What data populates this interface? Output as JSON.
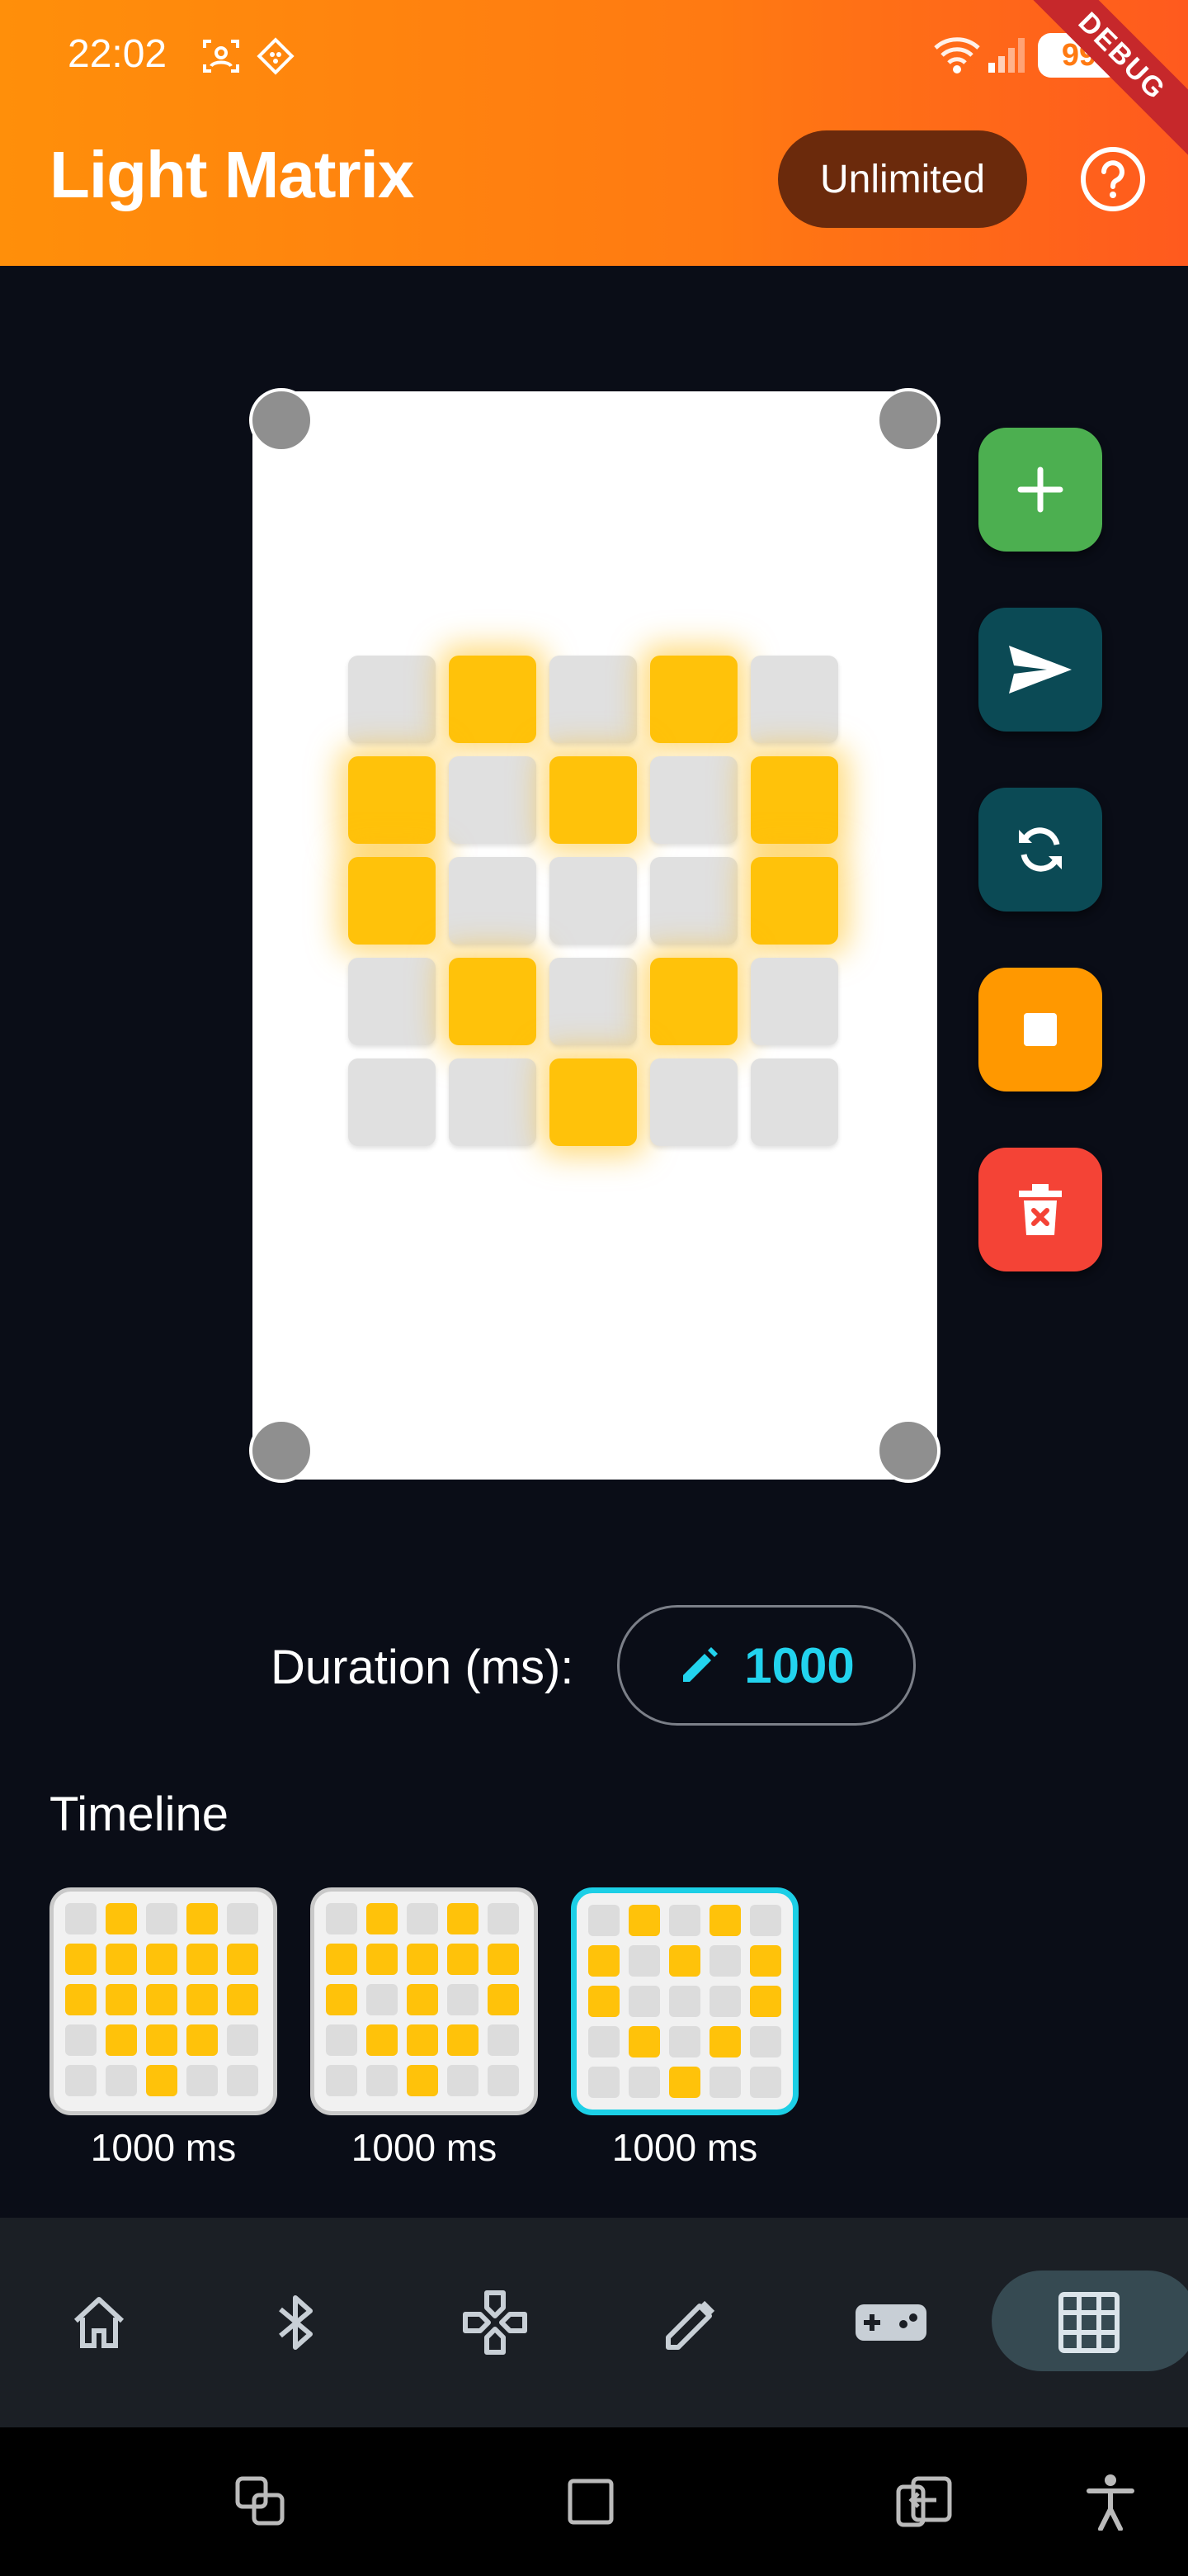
{
  "status_bar": {
    "time": "22:02",
    "battery": "99"
  },
  "debug_banner": "DEBUG",
  "app_bar": {
    "title": "Light Matrix",
    "plan_badge": "Unlimited",
    "help_icon": "help-circle-icon"
  },
  "matrix": {
    "rows": 5,
    "cols": 5,
    "on_color": "#ffc20a",
    "off_color": "#e0e0e0",
    "cells": [
      [
        0,
        1,
        0,
        1,
        0
      ],
      [
        1,
        0,
        1,
        0,
        1
      ],
      [
        1,
        0,
        0,
        0,
        1
      ],
      [
        0,
        1,
        0,
        1,
        0
      ],
      [
        0,
        0,
        1,
        0,
        0
      ]
    ]
  },
  "actions": [
    {
      "name": "add-frame-button",
      "icon": "plus-icon",
      "color": "#4caf50"
    },
    {
      "name": "send-button",
      "icon": "send-icon",
      "color": "#0b4a55"
    },
    {
      "name": "loop-button",
      "icon": "refresh-icon",
      "color": "#0b4a55"
    },
    {
      "name": "stop-button",
      "icon": "stop-icon",
      "color": "#ff9800"
    },
    {
      "name": "delete-button",
      "icon": "delete-icon",
      "color": "#f44336"
    }
  ],
  "duration": {
    "label": "Duration (ms):",
    "value": "1000",
    "icon": "pencil-icon"
  },
  "timeline": {
    "title": "Timeline",
    "selected_index": 2,
    "frames": [
      {
        "label": "1000 ms",
        "cells": [
          [
            0,
            1,
            0,
            1,
            0
          ],
          [
            1,
            1,
            1,
            1,
            1
          ],
          [
            1,
            1,
            1,
            1,
            1
          ],
          [
            0,
            1,
            1,
            1,
            0
          ],
          [
            0,
            0,
            1,
            0,
            0
          ]
        ]
      },
      {
        "label": "1000 ms",
        "cells": [
          [
            0,
            1,
            0,
            1,
            0
          ],
          [
            1,
            1,
            1,
            1,
            1
          ],
          [
            1,
            0,
            1,
            0,
            1
          ],
          [
            0,
            1,
            1,
            1,
            0
          ],
          [
            0,
            0,
            1,
            0,
            0
          ]
        ]
      },
      {
        "label": "1000 ms",
        "cells": [
          [
            0,
            1,
            0,
            1,
            0
          ],
          [
            1,
            0,
            1,
            0,
            1
          ],
          [
            1,
            0,
            0,
            0,
            1
          ],
          [
            0,
            1,
            0,
            1,
            0
          ],
          [
            0,
            0,
            1,
            0,
            0
          ]
        ]
      }
    ]
  },
  "bottom_nav": {
    "active": "matrix",
    "items": [
      "home-icon",
      "bluetooth-icon",
      "dpad-icon",
      "pencil-icon",
      "gamepad-icon",
      "grid-icon"
    ]
  },
  "system_nav": [
    "recent-apps-icon",
    "home-square-icon",
    "back-icon",
    "accessibility-icon"
  ]
}
